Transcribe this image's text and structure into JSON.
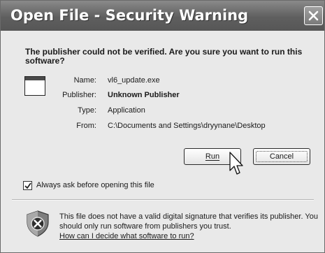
{
  "window": {
    "title": "Open File - Security Warning"
  },
  "dialog": {
    "heading": "The publisher could not be verified.  Are you sure you want to run this software?",
    "file_icon": "application-window-icon",
    "fields": {
      "name_label": "Name:",
      "name_value": "vl6_update.exe",
      "publisher_label": "Publisher:",
      "publisher_value": "Unknown Publisher",
      "type_label": "Type:",
      "type_value": "Application",
      "from_label": "From:",
      "from_value": "C:\\Documents and Settings\\dryynane\\Desktop"
    },
    "buttons": {
      "run_label": "Run",
      "cancel_label": "Cancel"
    },
    "checkbox": {
      "label": "Always ask before opening this file",
      "checked": true
    },
    "footer": {
      "icon": "shield-x-icon",
      "text": "This file does not have a valid digital signature that verifies its publisher.  You should only run software from publishers you trust.",
      "help_link": "How can I decide what software to run?"
    }
  }
}
